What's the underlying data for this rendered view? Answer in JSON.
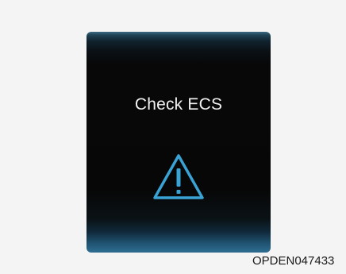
{
  "display": {
    "message": "Check ECS",
    "icon": "warning-triangle-icon",
    "accent_color": "#3aa3d6"
  },
  "figure_code": "OPDEN047433"
}
